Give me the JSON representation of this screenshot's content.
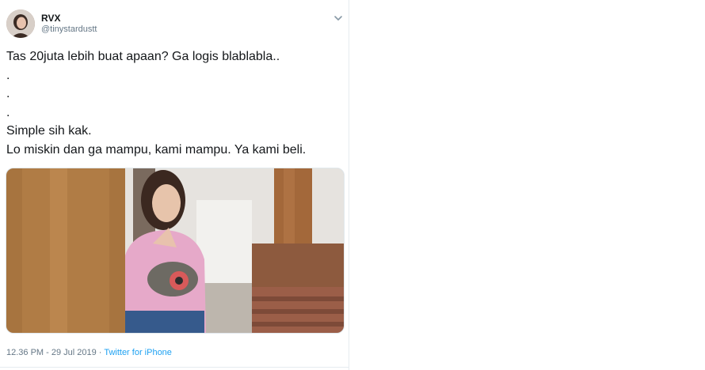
{
  "tweet": {
    "author": {
      "display_name": "RVX",
      "handle": "@tinystardustt"
    },
    "text": "Tas 20juta lebih buat apaan? Ga logis blablabla..\n.\n.\n.\nSimple sih kak.\nLo miskin dan ga mampu, kami mampu. Ya kami beli.",
    "timestamp": "12.36 PM - 29 Jul 2019",
    "separator": " · ",
    "source": "Twitter for iPhone"
  },
  "icons": {
    "more": "chevron-down-icon"
  },
  "colors": {
    "link": "#1da1f2",
    "secondary_text": "#657786",
    "border": "#e6ecf0"
  }
}
